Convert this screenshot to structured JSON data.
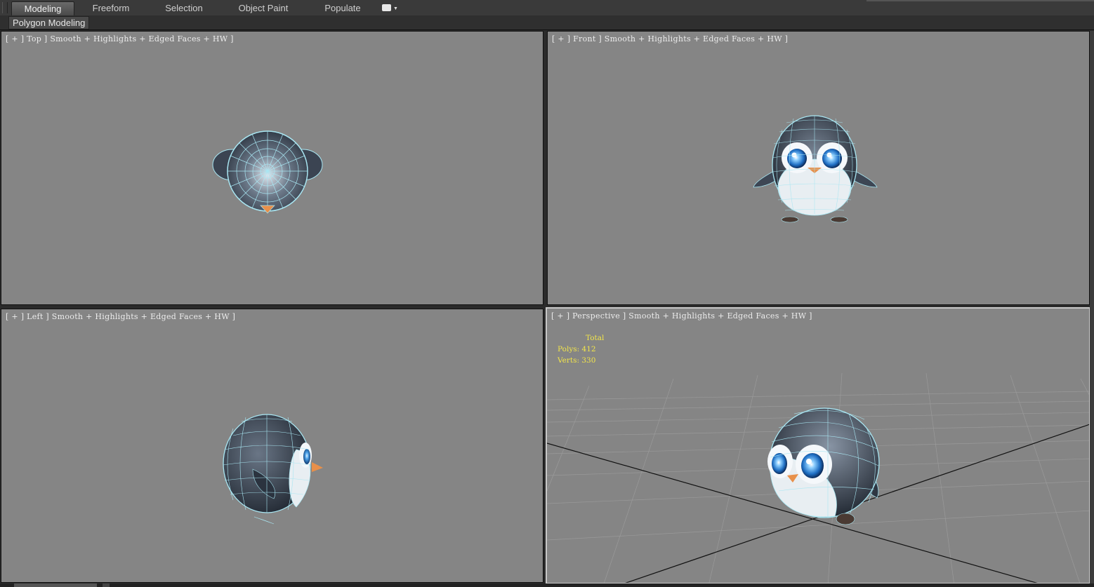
{
  "ribbon": {
    "tabs": [
      {
        "label": "Modeling",
        "active": true
      },
      {
        "label": "Freeform",
        "active": false
      },
      {
        "label": "Selection",
        "active": false
      },
      {
        "label": "Object Paint",
        "active": false
      },
      {
        "label": "Populate",
        "active": false
      }
    ]
  },
  "subpanel": {
    "label": "Polygon Modeling"
  },
  "viewports": {
    "top": {
      "label": "[ + ] Top ] Smooth + Highlights + Edged Faces + HW ]"
    },
    "front": {
      "label": "[ + ] Front ] Smooth + Highlights + Edged Faces + HW ]"
    },
    "left": {
      "label": "[ + ] Left ] Smooth + Highlights + Edged Faces + HW ]"
    },
    "perspective": {
      "label": "[ + ] Perspective ] Smooth + Highlights + Edged Faces + HW ]",
      "stats": {
        "header": "Total",
        "polys_label": "Polys:",
        "polys_value": "412",
        "verts_label": "Verts:",
        "verts_value": "330"
      }
    }
  },
  "colors": {
    "viewport_bg": "#858585",
    "wire": "#a9e6f2",
    "body_dark": "#2c3440",
    "belly": "#e8eef2",
    "eye": "#2a7fd4",
    "beak": "#e8904a",
    "stats_text": "#f2e54a"
  }
}
